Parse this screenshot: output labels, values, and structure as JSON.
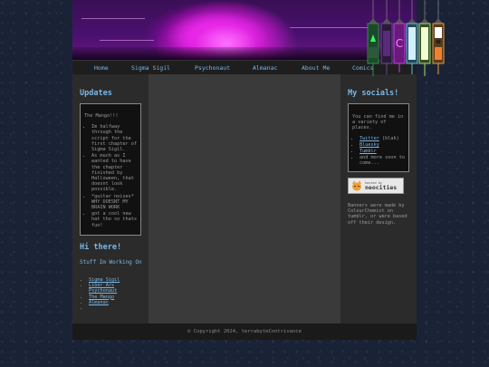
{
  "nav": [
    "Home",
    "Sigma Sigil",
    "Psychonaut",
    "Almanac",
    "About Me",
    "Comics"
  ],
  "left": {
    "updates_heading": "Updates",
    "updates_title": "The Mango!!!",
    "updates_items": [
      "Im halfway through the script for the first chapter of Sigma Sigil.",
      "As much as I wanted to have the chapter finished by Halloween, that doesnt look possible.",
      "*guitar noises* WHY DOESNT MY BRAIN WORK",
      "got a cool new hat tho so thats fun!"
    ],
    "hi_heading": "Hi there!",
    "working_heading": "Stuff Im Working On",
    "projects": [
      "Sigma Sigil",
      "Liber Ars Psychonaut",
      "The Mango",
      "Almanac",
      ""
    ]
  },
  "right": {
    "socials_heading": "My socials!",
    "socials_intro": "You can find me in a variety of places.",
    "socials": [
      {
        "name": "Twitter",
        "note": " (blah)"
      },
      {
        "name": "Bluesky",
        "note": ""
      },
      {
        "name": "Tumblr",
        "note": ""
      },
      {
        "name": "",
        "note": "and more soon to come..."
      }
    ],
    "neo_small": "hosted by",
    "neo_big": "neocities",
    "credit": "Banners were made by ColourChemist on tumblr, or were based off their design."
  },
  "footer": "© Copyright 2024, terrabyteContrivance",
  "colors": {
    "accent": "#7ab8e8",
    "panel": "#2b2b2b",
    "center": "#3a3a3a"
  }
}
